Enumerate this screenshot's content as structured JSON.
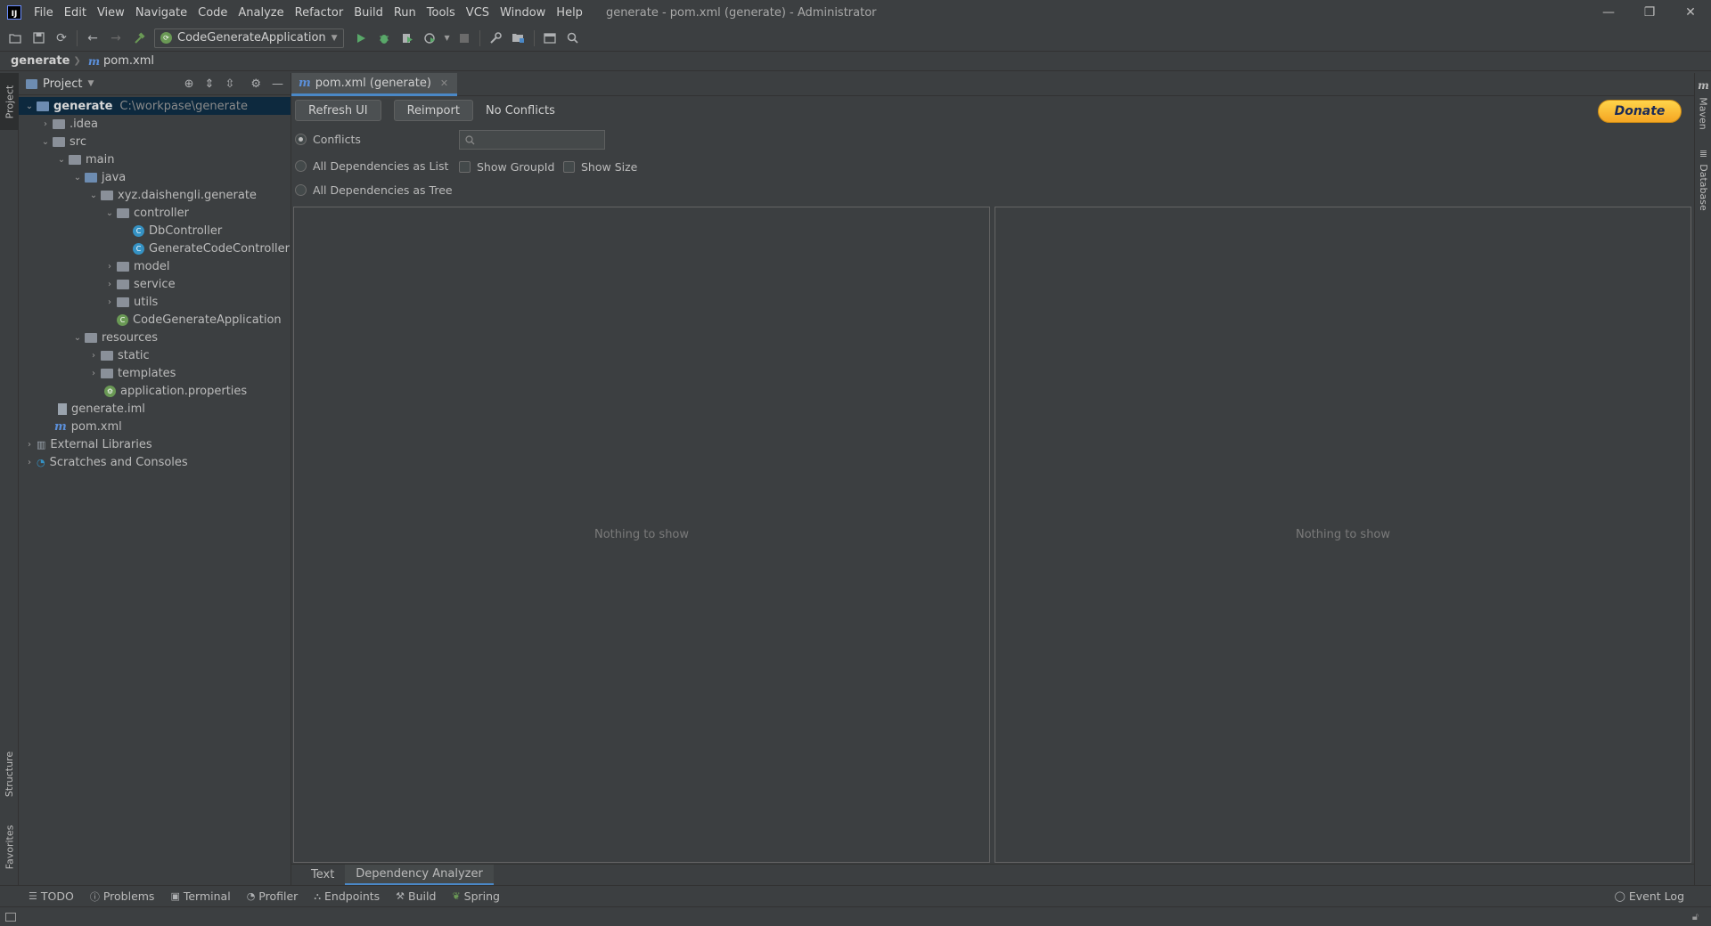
{
  "window": {
    "menu": [
      "File",
      "Edit",
      "View",
      "Navigate",
      "Code",
      "Analyze",
      "Refactor",
      "Build",
      "Run",
      "Tools",
      "VCS",
      "Window",
      "Help"
    ],
    "title": "generate - pom.xml (generate) - Administrator",
    "controls": {
      "minimize": "—",
      "restore": "❐",
      "close": "✕"
    }
  },
  "toolbar": {
    "run_config": "CodeGenerateApplication"
  },
  "breadcrumb": {
    "project": "generate",
    "file": "pom.xml"
  },
  "left_strip": {
    "project": "Project",
    "structure": "Structure",
    "favorites": "Favorites"
  },
  "project_panel": {
    "title": "Project",
    "tree": [
      {
        "label": "generate",
        "hint": "C:\\workpase\\generate"
      },
      {
        "label": ".idea"
      },
      {
        "label": "src"
      },
      {
        "label": "main"
      },
      {
        "label": "java"
      },
      {
        "label": "xyz.daishengli.generate"
      },
      {
        "label": "controller"
      },
      {
        "label": "DbController"
      },
      {
        "label": "GenerateCodeController"
      },
      {
        "label": "model"
      },
      {
        "label": "service"
      },
      {
        "label": "utils"
      },
      {
        "label": "CodeGenerateApplication"
      },
      {
        "label": "resources"
      },
      {
        "label": "static"
      },
      {
        "label": "templates"
      },
      {
        "label": "application.properties"
      },
      {
        "label": "generate.iml"
      },
      {
        "label": "pom.xml"
      },
      {
        "label": "External Libraries"
      },
      {
        "label": "Scratches and Consoles"
      }
    ]
  },
  "editor": {
    "tab_label": "pom.xml (generate)",
    "refresh_ui": "Refresh UI",
    "reimport": "Reimport",
    "status": "No Conflicts",
    "donate": "Donate",
    "radio_conflicts": "Conflicts",
    "radio_list": "All Dependencies as List",
    "radio_tree": "All Dependencies as Tree",
    "show_group_id": "Show GroupId",
    "show_size": "Show Size",
    "left_pane_empty": "Nothing to show",
    "right_pane_empty": "Nothing to show",
    "bottom_tabs": [
      "Text",
      "Dependency Analyzer"
    ]
  },
  "right_strip": {
    "maven": "Maven",
    "database": "Database"
  },
  "toolwindows": [
    "TODO",
    "Problems",
    "Terminal",
    "Profiler",
    "Endpoints",
    "Build",
    "Spring"
  ],
  "event_log": "Event Log",
  "colors": {
    "background": "#3c3f41",
    "selection": "#0d293e",
    "accent": "#4a88c7",
    "donate": "#f5a623"
  }
}
